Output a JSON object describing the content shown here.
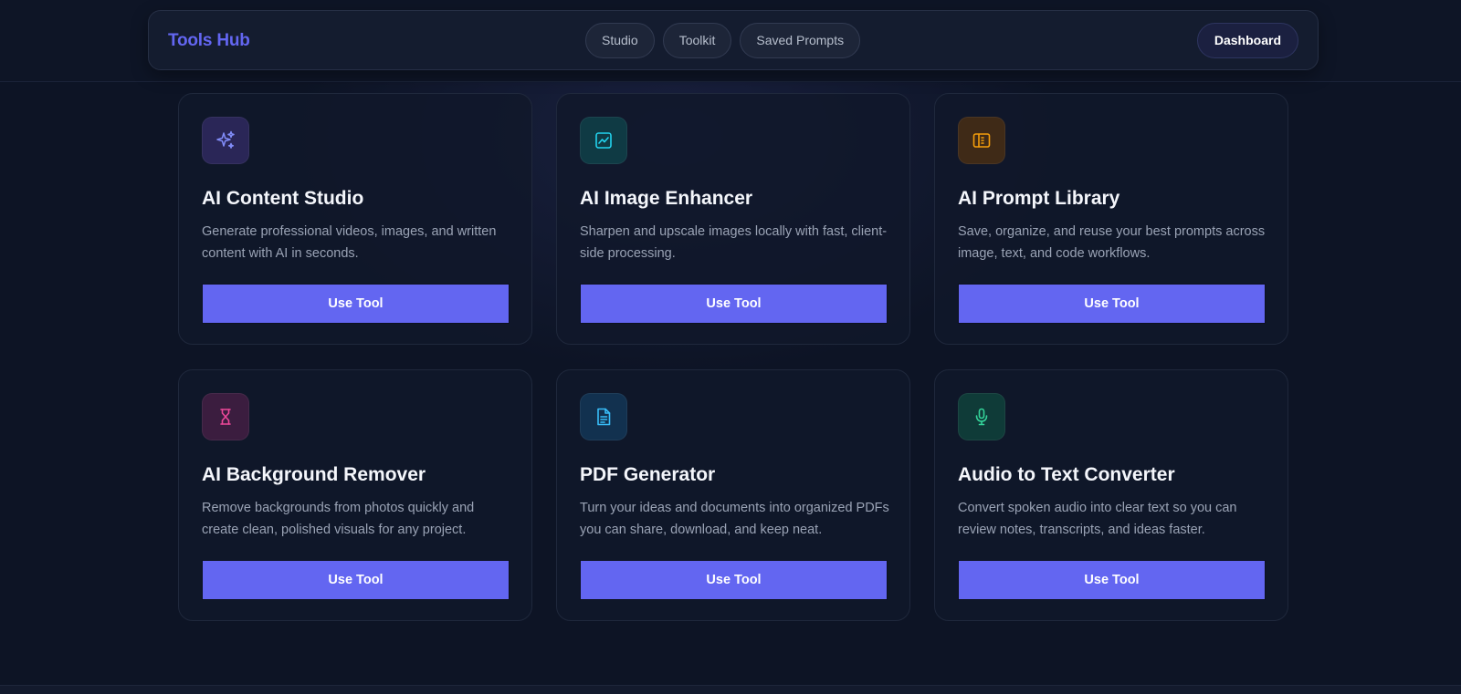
{
  "header": {
    "brand": "Tools Hub",
    "nav": [
      "Studio",
      "Toolkit",
      "Saved Prompts"
    ],
    "dashboard_label": "Dashboard"
  },
  "tools": [
    {
      "title": "AI Content Studio",
      "description": "Generate professional videos, images, and written content with AI in seconds.",
      "button": "Use Tool",
      "icon": "sparkles-icon",
      "icon_color": "#818cf8",
      "icon_bg": "#2a2657"
    },
    {
      "title": "AI Image Enhancer",
      "description": "Sharpen and upscale images locally with fast, client-side processing.",
      "button": "Use Tool",
      "icon": "image-chart-icon",
      "icon_color": "#22d3ee",
      "icon_bg": "#0f3a44"
    },
    {
      "title": "AI Prompt Library",
      "description": "Save, organize, and reuse your best prompts across image, text, and code workflows.",
      "button": "Use Tool",
      "icon": "book-icon",
      "icon_color": "#f59e0b",
      "icon_bg": "#3f2a17"
    },
    {
      "title": "AI Background Remover",
      "description": "Remove backgrounds from photos quickly and create clean, polished visuals for any project.",
      "button": "Use Tool",
      "icon": "hourglass-icon",
      "icon_color": "#ec4899",
      "icon_bg": "#3b1d3f"
    },
    {
      "title": "PDF Generator",
      "description": "Turn your ideas and documents into organized PDFs you can share, download, and keep neat.",
      "button": "Use Tool",
      "icon": "document-icon",
      "icon_color": "#38bdf8",
      "icon_bg": "#12314f"
    },
    {
      "title": "Audio to Text Converter",
      "description": "Convert spoken audio into clear text so you can review notes, transcripts, and ideas faster.",
      "button": "Use Tool",
      "icon": "microphone-icon",
      "icon_color": "#34d399",
      "icon_bg": "#0f3b38"
    }
  ],
  "colors": {
    "accent": "#6366f1",
    "background": "#0d1425",
    "card_background": "#11182a"
  }
}
